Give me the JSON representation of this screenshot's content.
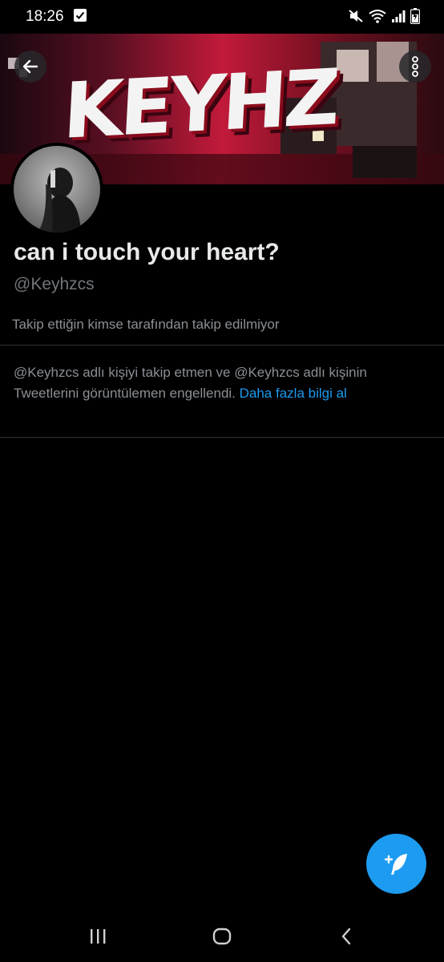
{
  "status_bar": {
    "time": "18:26",
    "icons": [
      "check-notification-icon",
      "mute-icon",
      "wifi-icon",
      "signal-icon",
      "battery-icon"
    ]
  },
  "banner": {
    "title_art": "KEYHZ"
  },
  "profile": {
    "display_name": "can i touch your heart?",
    "handle": "@Keyhzcs",
    "followed_by_note": "Takip ettiğin kimse tarafından takip edilmiyor"
  },
  "blocked_notice": {
    "text": "@Keyhzcs adlı kişiyi takip etmen ve @Keyhzcs adlı kişinin Tweetlerini görüntülemen engellendi. ",
    "link_label": "Daha fazla bilgi al"
  },
  "colors": {
    "accent": "#1d9bf0",
    "background": "#000000",
    "primary_text": "#e7e9ea",
    "secondary_text": "#71767b",
    "divider": "#2f3336"
  },
  "fab": {
    "icon": "compose-tweet-icon"
  },
  "nav_bar": {
    "icons": [
      "recent-apps-icon",
      "home-icon",
      "back-nav-icon"
    ]
  }
}
